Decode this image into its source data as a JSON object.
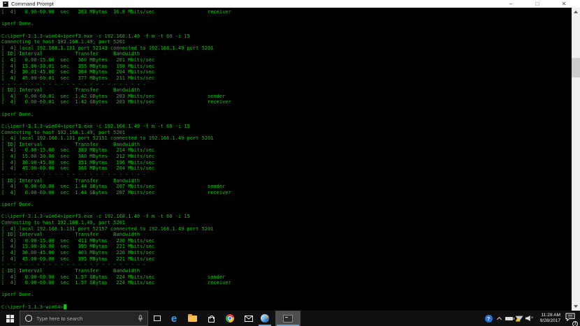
{
  "window": {
    "title": "Command Prompt",
    "controls": {
      "minimize": "–",
      "maximize": "□",
      "close": "✕"
    }
  },
  "terminal": {
    "background_color": "#000000",
    "text_color": "#00cc00",
    "prompt_line": "C:\\iperf-3.1.3-win64>",
    "lines": [
      "[  4]   0.00-60.00  sec   263 MBytes  36.8 Mbits/sec                  receiver",
      "",
      "iperf Done.",
      "",
      "C:\\iperf-3.1.3-win64>iperf3.exe -c 192.168.1.49 -f m -t 60 -i 15",
      "Connecting to host 192.168.1.49, port 5201",
      "[  4] local 192.168.1.131 port 52143 connected to 192.168.1.49 port 5201",
      "[ ID] Interval           Transfer     Bandwidth",
      "[  4]   0.00-15.00  sec   360 MBytes   201 Mbits/sec",
      "[  4]  15.00-30.01  sec   355 MBytes   198 Mbits/sec",
      "[  4]  30.01-45.00  sec   364 MBytes   204 Mbits/sec",
      "[  4]  45.00-60.01  sec   377 MBytes   211 Mbits/sec",
      "- - - - - - - - - - - - - - - - - - - - - - - - -",
      "[ ID] Interval           Transfer     Bandwidth",
      "[  4]   0.00-60.01  sec  1.42 GBytes   203 Mbits/sec                  sender",
      "[  4]   0.00-60.01  sec  1.42 GBytes   203 Mbits/sec                  receiver",
      "",
      "iperf Done.",
      "",
      "C:\\iperf-3.1.3-win64>iperf3.exe -c 192.168.1.49 -f m -t 60 -i 15",
      "Connecting to host 192.168.1.49, port 5201",
      "[  4] local 192.168.1.131 port 52151 connected to 192.168.1.49 port 5201",
      "[ ID] Interval           Transfer     Bandwidth",
      "[  4]   0.00-15.00  sec   383 MBytes   214 Mbits/sec",
      "[  4]  15.00-30.00  sec   380 MBytes   212 Mbits/sec",
      "[  4]  30.00-45.00  sec   351 MBytes   196 Mbits/sec",
      "[  4]  45.00-60.00  sec   366 MBytes   204 Mbits/sec",
      "- - - - - - - - - - - - - - - - - - - - - - - - -",
      "[ ID] Interval           Transfer     Bandwidth",
      "[  4]   0.00-60.00  sec  1.44 GBytes   207 Mbits/sec                  sender",
      "[  4]   0.00-60.00  sec  1.44 GBytes   207 Mbits/sec                  receiver",
      "",
      "iperf Done.",
      "",
      "C:\\iperf-3.1.3-win64>iperf3.exe -c 192.168.1.49 -f m -t 60 -i 15",
      "Connecting to host 192.168.1.49, port 5201",
      "[  4] local 192.168.1.131 port 52157 connected to 192.168.1.49 port 5201",
      "[ ID] Interval           Transfer     Bandwidth",
      "[  4]   0.00-15.00  sec   411 MBytes   230 Mbits/sec",
      "[  4]  15.00-30.00  sec   395 MBytes   221 Mbits/sec",
      "[  4]  30.00-45.00  sec   403 MBytes   226 Mbits/sec",
      "[  4]  45.00-60.00  sec   395 MBytes   221 Mbits/sec",
      "- - - - - - - - - - - - - - - - - - - - - - - - -",
      "[ ID] Interval           Transfer     Bandwidth",
      "[  4]   0.00-60.00  sec  1.57 GBytes   224 Mbits/sec                  sender",
      "[  4]   0.00-60.00  sec  1.57 GBytes   224 Mbits/sec                  receiver",
      "",
      "iperf Done.",
      ""
    ]
  },
  "taskbar": {
    "search": {
      "placeholder": "Type here to search"
    },
    "edge_glyph": "e",
    "apps": [
      {
        "name": "task-view"
      },
      {
        "name": "edge"
      },
      {
        "name": "file-explorer"
      },
      {
        "name": "store"
      },
      {
        "name": "chrome"
      },
      {
        "name": "mail"
      },
      {
        "name": "planet-app",
        "running": true
      },
      {
        "name": "command-prompt",
        "running": true,
        "active": true
      }
    ],
    "tray": {
      "help_glyph": "?",
      "volume_muted_glyph": "×",
      "time": "11:28 AM",
      "date": "9/28/2017",
      "notification_count": "3",
      "icons": [
        "help",
        "hidden-icons-chevron",
        "battery",
        "network-warning",
        "volume-muted",
        "action-center"
      ]
    }
  }
}
